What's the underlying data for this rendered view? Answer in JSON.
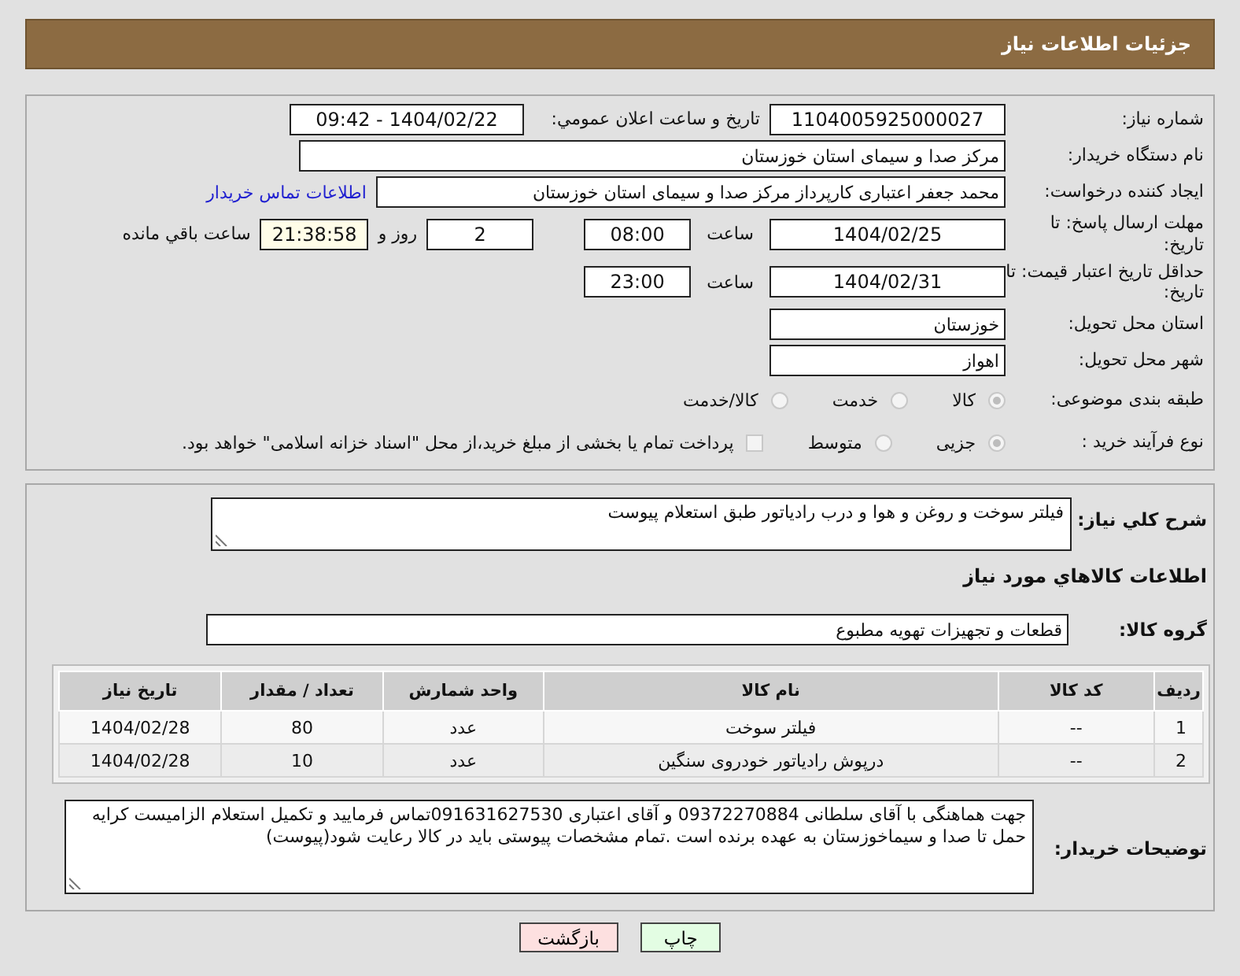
{
  "header": {
    "title": "جزئیات اطلاعات نیاز"
  },
  "details": {
    "need_number": {
      "label": "شماره نیاز:",
      "value": "1104005925000027"
    },
    "announce": {
      "label": "تاریخ و ساعت اعلان عمومي:",
      "value": "1404/02/22 - 09:42"
    },
    "buyer_org": {
      "label": "نام دستگاه خریدار:",
      "value": "مرکز صدا و سیمای استان خوزستان"
    },
    "creator": {
      "label": "ایجاد کننده درخواست:",
      "value": "محمد جعفر اعتباری کارپرداز مرکز صدا و سیمای استان خوزستان",
      "link": "اطلاعات تماس خریدار"
    },
    "reply_deadline": {
      "label": "مهلت ارسال پاسخ: تا تاریخ:",
      "date": "1404/02/25",
      "time_label": "ساعت",
      "time": "08:00",
      "days": "2",
      "days_label": "روز و",
      "remaining": "21:38:58",
      "remaining_label": "ساعت باقي مانده"
    },
    "price_validity": {
      "label": "حداقل تاریخ اعتبار قیمت: تا تاریخ:",
      "date": "1404/02/31",
      "time_label": "ساعت",
      "time": "23:00"
    },
    "province": {
      "label": "استان محل تحویل:",
      "value": "خوزستان"
    },
    "city": {
      "label": "شهر محل تحویل:",
      "value": "اهواز"
    },
    "category": {
      "label": "طبقه بندی موضوعی:",
      "options": [
        {
          "label": "کالا",
          "selected": true
        },
        {
          "label": "خدمت",
          "selected": false
        },
        {
          "label": "کالا/خدمت",
          "selected": false
        }
      ]
    },
    "process": {
      "label": "نوع فرآیند خرید :",
      "options": [
        {
          "label": "جزیی",
          "selected": true
        },
        {
          "label": "متوسط",
          "selected": false
        }
      ],
      "treasury": {
        "checked": false,
        "text": "پرداخت تمام یا بخشی از مبلغ خرید،از محل \"اسناد خزانه اسلامی\" خواهد بود."
      }
    }
  },
  "summary": {
    "label": "شرح كلي نياز:",
    "value": "فیلتر سوخت و روغن و هوا و درب رادیاتور طبق استعلام پیوست"
  },
  "goods_heading": "اطلاعات كالاهاي مورد نياز",
  "group": {
    "label": "گروه کالا:",
    "value": "قطعات و تجهیزات تهویه مطبوع"
  },
  "table": {
    "columns": [
      "ردیف",
      "کد کالا",
      "نام کالا",
      "واحد شمارش",
      "تعداد / مقدار",
      "تاریخ نیاز"
    ],
    "rows": [
      [
        "1",
        "--",
        "فیلتر سوخت",
        "عدد",
        "80",
        "1404/02/28"
      ],
      [
        "2",
        "--",
        "درپوش رادیاتور خودروی سنگین",
        "عدد",
        "10",
        "1404/02/28"
      ]
    ]
  },
  "buyer_notes": {
    "label": "توضیحات خریدار:",
    "value": "جهت هماهنگی با آقای سلطانی 09372270884 و آقای اعتباری 091631627530تماس فرمایید و تکمیل استعلام الزامیست کرایه حمل تا صدا و سیماخوزستان به عهده برنده است .تمام مشخصات پیوستی باید در کالا رعایت شود(پیوست)"
  },
  "buttons": [
    {
      "label": "چاپ",
      "kind": "print"
    },
    {
      "label": "بازگشت",
      "kind": "back"
    }
  ]
}
